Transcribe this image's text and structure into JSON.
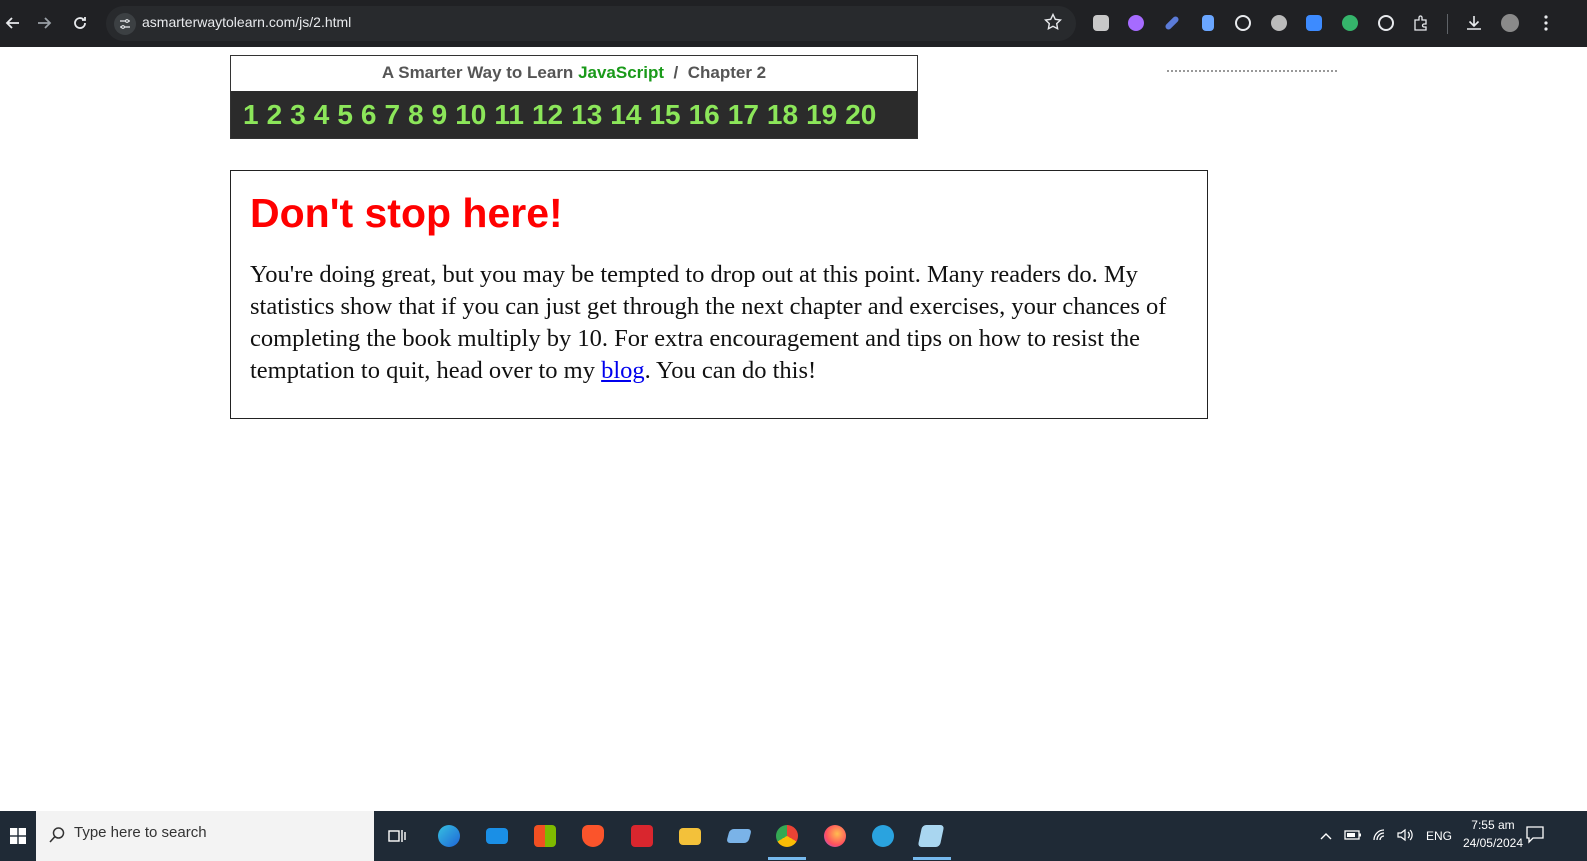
{
  "browser": {
    "url": "asmarterwaytolearn.com/js/2.html"
  },
  "page": {
    "header_prefix": "A Smarter Way to Learn",
    "header_highlight": "JavaScript",
    "header_separator": "/",
    "header_chapter": "Chapter 2",
    "chapters": [
      "1",
      "2",
      "3",
      "4",
      "5",
      "6",
      "7",
      "8",
      "9",
      "10",
      "11",
      "12",
      "13",
      "14",
      "15",
      "16",
      "17",
      "18",
      "19",
      "20"
    ],
    "heading": "Don't stop here!",
    "body_before_link": "You're doing great, but you may be tempted to drop out at this point. Many readers do. My statistics show that if you can just get through the next chapter and exercises, your chances of completing the book multiply by 10. For extra encouragement and tips on how to resist the temptation to quit, head over to my ",
    "link_text": "blog",
    "body_after_link": ". You can do this!"
  },
  "taskbar": {
    "search_placeholder": "Type here to search",
    "lang": "ENG",
    "time": "7:55 am",
    "date": "24/05/2024"
  },
  "colors": {
    "heading": "#ff0000",
    "chapter_links": "#8ce65a",
    "javascript": "#1a9a1a",
    "link": "#0000ee"
  }
}
